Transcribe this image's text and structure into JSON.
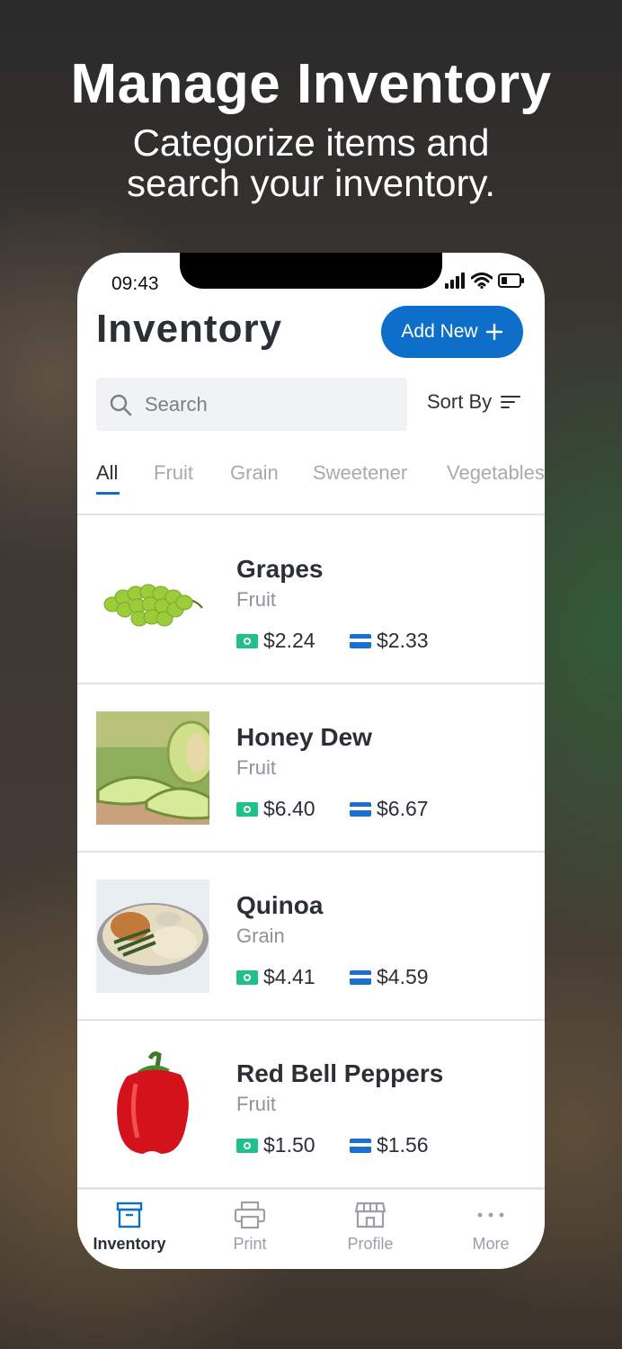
{
  "hero": {
    "title": "Manage Inventory",
    "subtitle": "Categorize items and\nsearch your inventory."
  },
  "status_bar": {
    "time": "09:43"
  },
  "header": {
    "title": "Inventory",
    "add_button_label": "Add New"
  },
  "search": {
    "placeholder": "Search",
    "value": ""
  },
  "sort": {
    "label": "Sort By"
  },
  "tabs": [
    "All",
    "Fruit",
    "Grain",
    "Sweetener",
    "Vegetables"
  ],
  "active_tab": "All",
  "items": [
    {
      "name": "Grapes",
      "category": "Fruit",
      "cash_price": "$2.24",
      "card_price": "$2.33"
    },
    {
      "name": "Honey Dew",
      "category": "Fruit",
      "cash_price": "$6.40",
      "card_price": "$6.67"
    },
    {
      "name": "Quinoa",
      "category": "Grain",
      "cash_price": "$4.41",
      "card_price": "$4.59"
    },
    {
      "name": "Red Bell Peppers",
      "category": "Fruit",
      "cash_price": "$1.50",
      "card_price": "$1.56"
    }
  ],
  "bottom_nav": [
    {
      "label": "Inventory",
      "icon": "archive-box-icon",
      "active": true
    },
    {
      "label": "Print",
      "icon": "printer-icon",
      "active": false
    },
    {
      "label": "Profile",
      "icon": "store-icon",
      "active": false
    },
    {
      "label": "More",
      "icon": "more-dots-icon",
      "active": false
    }
  ],
  "colors": {
    "accent": "#0d6fc9",
    "cash_icon": "#1fc08a",
    "card_icon": "#1a6fd0",
    "title_text": "#2b2f36"
  }
}
